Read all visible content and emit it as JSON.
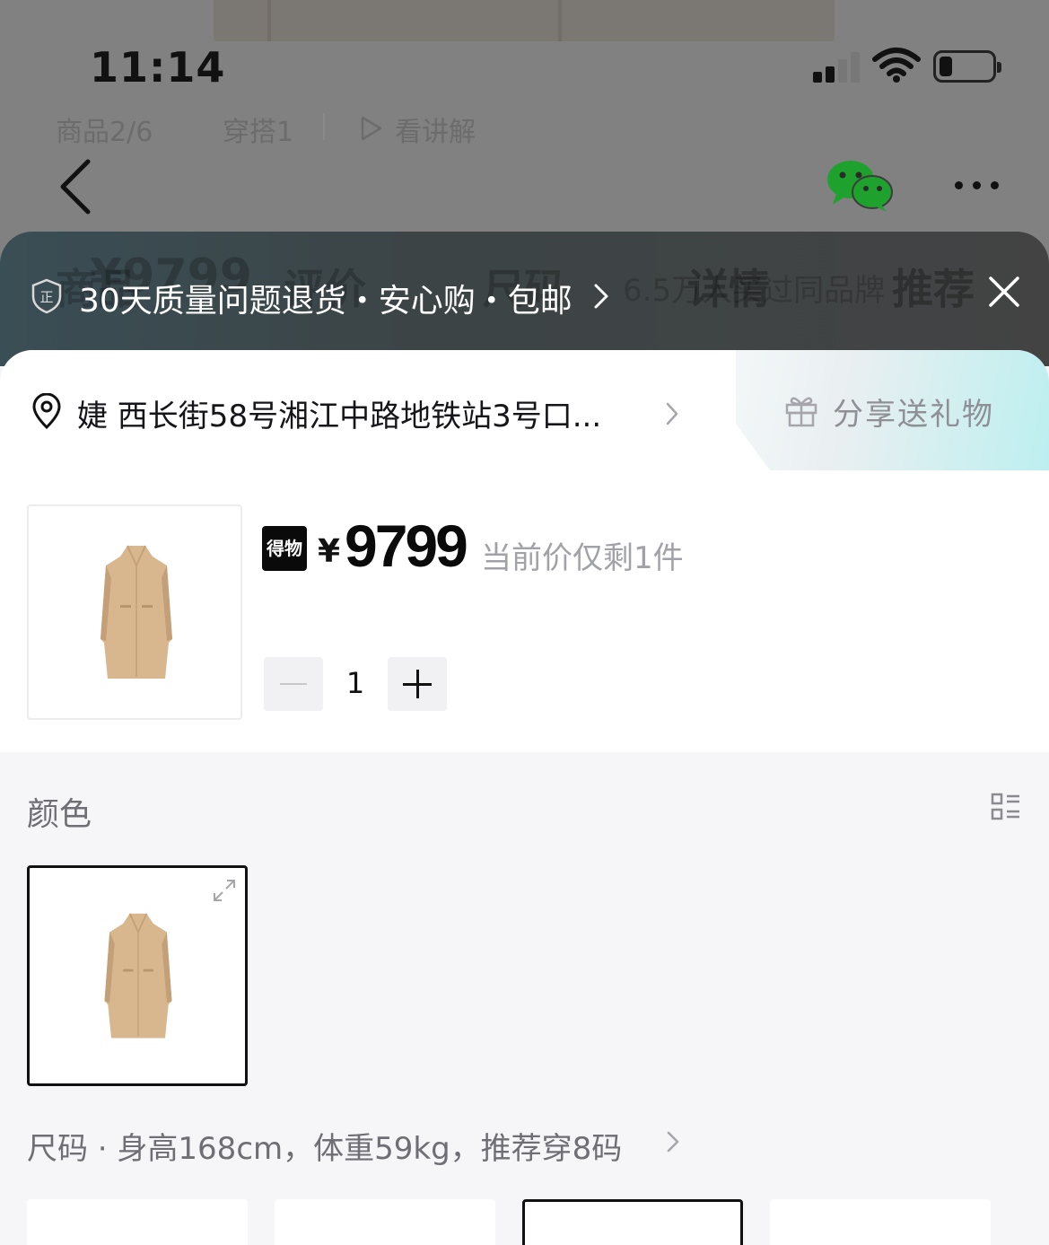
{
  "status_bar": {
    "time": "11:14"
  },
  "background_page": {
    "tabs": [
      {
        "label": "商品2/6"
      },
      {
        "label": "穿搭1"
      },
      {
        "label": "看讲解"
      }
    ],
    "ghost_nav": [
      "商品",
      "评价",
      "尺码",
      "详情",
      "推荐"
    ],
    "ghost_price": "¥9799",
    "ghost_note": "6.5万人买过同品牌"
  },
  "banner": {
    "text": "30天质量问题退货・安心购・包邮",
    "shield_badge": "正"
  },
  "sheet": {
    "address": "婕  西长街58号湘江中路地铁站3号口...",
    "share_label": "分享送礼物",
    "product": {
      "brand_logo": "得物",
      "currency": "¥",
      "price": "9799",
      "price_note": "当前价仅剩1件",
      "quantity": "1"
    },
    "color_section": {
      "title": "颜色"
    },
    "size_section": {
      "title": "尺码 · 身高168cm，体重59kg，推荐穿8码"
    }
  },
  "colors": {
    "coat": "#d8b78f",
    "coat_shadow": "#c4a079",
    "banner_text": "#ffffff",
    "price": "#0a0a0a",
    "muted": "#a1a1a8",
    "wechat_green": "#1fa12e"
  }
}
